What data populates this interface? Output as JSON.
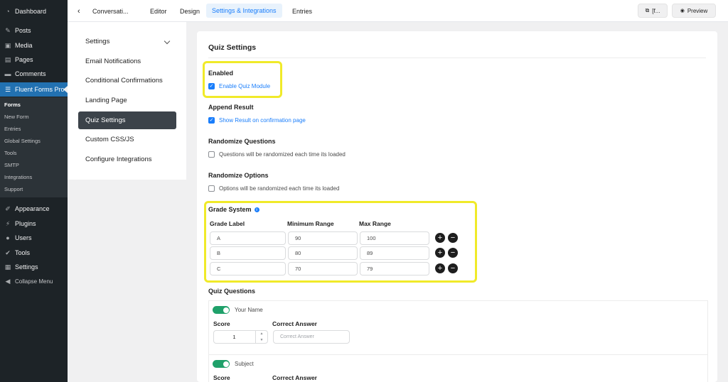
{
  "wp_sidebar": {
    "items_top": [
      {
        "label": "Dashboard",
        "icon": "dashboard-icon"
      }
    ],
    "items_mid": [
      {
        "label": "Posts",
        "icon": "pin-icon"
      },
      {
        "label": "Media",
        "icon": "media-icon"
      },
      {
        "label": "Pages",
        "icon": "pages-icon"
      },
      {
        "label": "Comments",
        "icon": "comments-icon"
      }
    ],
    "active_item": {
      "label": "Fluent Forms Pro",
      "icon": "fluent-forms-icon"
    },
    "submenu": [
      "Forms",
      "New Form",
      "Entries",
      "Global Settings",
      "Tools",
      "SMTP",
      "Integrations",
      "Support"
    ],
    "items_bottom": [
      {
        "label": "Appearance",
        "icon": "brush-icon"
      },
      {
        "label": "Plugins",
        "icon": "plugin-icon"
      },
      {
        "label": "Users",
        "icon": "users-icon"
      },
      {
        "label": "Tools",
        "icon": "wrench-icon"
      },
      {
        "label": "Settings",
        "icon": "settings-icon"
      },
      {
        "label": "Collapse Menu",
        "icon": "collapse-icon"
      }
    ],
    "colors": {
      "bg": "#1d2327",
      "active": "#2271b1"
    }
  },
  "topbar": {
    "form_name": "Conversati...",
    "tabs": [
      "Editor",
      "Design",
      "Settings & Integrations",
      "Entries"
    ],
    "active_tab": "Settings & Integrations",
    "shortcode_label": "[f...",
    "preview_label": "Preview"
  },
  "settings_menu": {
    "items": [
      "Settings",
      "Email Notifications",
      "Conditional Confirmations",
      "Landing Page",
      "Quiz Settings",
      "Custom CSS/JS",
      "Configure Integrations"
    ],
    "active": "Quiz Settings"
  },
  "quiz": {
    "title": "Quiz Settings",
    "enabled_label": "Enabled",
    "enabled_checkbox": "Enable Quiz Module",
    "append_label": "Append Result",
    "append_checkbox": "Show Result on confirmation page",
    "randomize_q_label": "Randomize Questions",
    "randomize_q_checkbox": "Questions will be randomized each time its loaded",
    "randomize_o_label": "Randomize Options",
    "randomize_o_checkbox": "Options will be randomized each time its loaded",
    "grade_label": "Grade System",
    "grade_headers": [
      "Grade Label",
      "Minimum Range",
      "Max Range"
    ],
    "grades": [
      {
        "label": "A",
        "min": "90",
        "max": "100"
      },
      {
        "label": "B",
        "min": "80",
        "max": "89"
      },
      {
        "label": "C",
        "min": "70",
        "max": "79"
      }
    ],
    "questions_label": "Quiz Questions",
    "questions": [
      {
        "name": "Your Name",
        "score": "1",
        "answer_placeholder": "Correct Answer"
      },
      {
        "name": "Subject"
      }
    ],
    "score_label": "Score",
    "answer_label": "Correct Answer",
    "colors": {
      "accent": "#1a7efb",
      "highlight": "#f0ea29",
      "toggle": "#1fa16a"
    }
  }
}
